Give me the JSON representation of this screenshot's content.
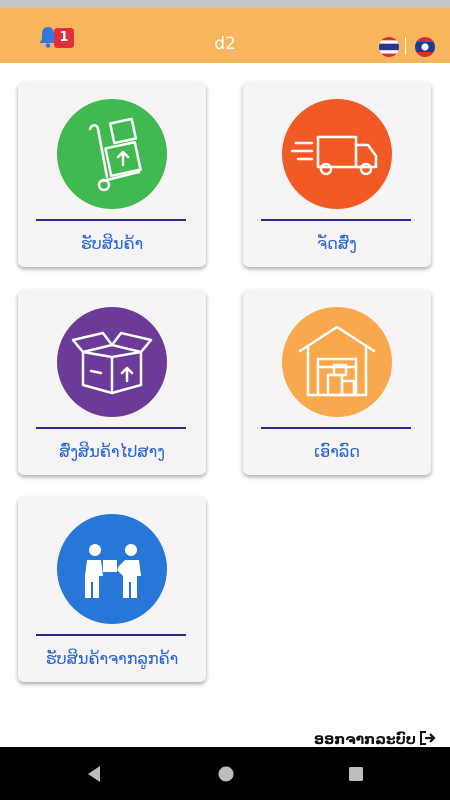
{
  "header": {
    "title": "d2",
    "notification_count": "1",
    "icons": [
      "bell-icon",
      "thai-flag-icon",
      "lao-flag-icon"
    ],
    "background_color": "#f8b65c",
    "badge_color": "#e2303b"
  },
  "menu": [
    {
      "label": "ຮັບສິນຄ້າ",
      "icon": "hand-truck-icon",
      "color": "#3fb950"
    },
    {
      "label": "ຈັດສົ່ງ",
      "icon": "delivery-truck-icon",
      "color": "#f15a24"
    },
    {
      "label": "ສົ່ງສິນຄ້າໄປສາງ",
      "icon": "open-box-icon",
      "color": "#6c3a99"
    },
    {
      "label": "ເອົາລົດ",
      "icon": "warehouse-icon",
      "color": "#f9a84d"
    },
    {
      "label": "ຮັບສິນຄ້າຈາກລູກຄ້າ",
      "icon": "hand-over-package-icon",
      "color": "#2677d8"
    }
  ],
  "footer": {
    "logout_label": "ອອກຈາກລະບົບ",
    "logout_icon": "sign-out-icon"
  },
  "navbar": {
    "icons": [
      "back-icon",
      "home-icon",
      "recent-apps-icon"
    ]
  },
  "accent_text_color": "#2864d8",
  "divider_color": "#2b2a8c"
}
